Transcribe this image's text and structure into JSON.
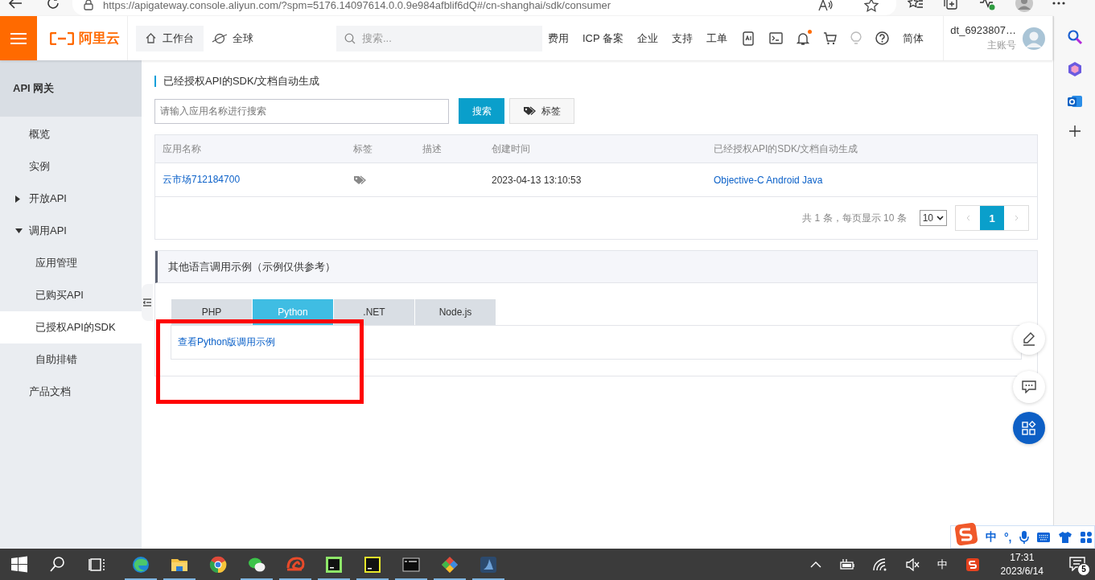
{
  "browser": {
    "url": "https://apigateway.console.aliyun.com/?spm=5176.14097614.0.0.9e984afblif6dQ#/cn-shanghai/sdk/consumer"
  },
  "header": {
    "logo": "阿里云",
    "workbench": "工作台",
    "region": "全球",
    "search": {
      "placeholder": "搜索..."
    },
    "links": [
      "费用",
      "ICP 备案",
      "企业",
      "支持",
      "工单"
    ],
    "notification_dot": true,
    "language": "简体",
    "user": "dt_6923807…",
    "account_type": "主账号"
  },
  "sidebar": {
    "title": "API 网关",
    "items": [
      {
        "kind": "link",
        "label": "概览",
        "selected": false
      },
      {
        "kind": "link",
        "label": "实例",
        "selected": false
      },
      {
        "kind": "group",
        "label": "开放API",
        "selected": false,
        "expanded": false
      },
      {
        "kind": "group",
        "label": "调用API",
        "selected": false,
        "expanded": true,
        "children": [
          {
            "kind": "link",
            "label": "应用管理",
            "selected": false
          },
          {
            "kind": "link",
            "label": "已购买API",
            "selected": false
          },
          {
            "kind": "link",
            "label": "已授权API的SDK",
            "selected": true
          },
          {
            "kind": "link",
            "label": "自助排错",
            "selected": false
          }
        ]
      },
      {
        "kind": "link",
        "label": "产品文档",
        "selected": false
      }
    ]
  },
  "sdk_section": {
    "title": "已经授权API的SDK/文档自动生成",
    "search": {
      "placeholder": "请输入应用名称进行搜索"
    },
    "search_button": "搜索",
    "tag_button": "标签",
    "table": {
      "columns": [
        "应用名称",
        "标签",
        "描述",
        "创建时间",
        "已经授权API的SDK/文档自动生成"
      ],
      "rows": [
        {
          "app_name": "云市场712184700",
          "created": "2023-04-13 13:10:53",
          "sdks": "Objective-C Android Java"
        }
      ]
    },
    "pagination": {
      "summary": "共 1 条，每页显示 10 条",
      "page_size": "10",
      "pages": [
        {
          "label": "1",
          "selected": true
        }
      ]
    }
  },
  "examples": {
    "title": "其他语言调用示例（示例仅供参考）",
    "tabs": [
      {
        "label": "PHP",
        "selected": false
      },
      {
        "label": "Python",
        "selected": true
      },
      {
        "label": ".NET",
        "selected": false
      },
      {
        "label": "Node.js",
        "selected": false
      }
    ],
    "link": "查看Python版调用示例"
  },
  "highlight_box": true,
  "ime_bar": {
    "mode": "中",
    "punctuation": "°,"
  },
  "taskbar": {
    "ime": "中",
    "time": "17:31",
    "date": "2023/6/14",
    "notifications": "5"
  }
}
